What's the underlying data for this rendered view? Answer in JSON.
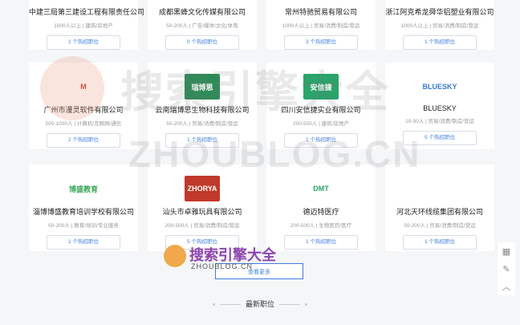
{
  "cards": [
    {
      "name": "中建三局第三建设工程有限责任公司",
      "meta": "1000人以上 | 建筑/房地产",
      "jobs": "1 个热招职位",
      "logo_text": "",
      "logo_bg": "#ffffff",
      "logo_color": "#333333"
    },
    {
      "name": "成都黑蜂文化传媒有限公司",
      "meta": "50-200人 | 广告/媒体/文化/体育",
      "jobs": "0 个热招职位",
      "logo_text": "",
      "logo_bg": "#ffffff",
      "logo_color": "#333333"
    },
    {
      "name": "常州特驰贸易有限公司",
      "meta": "1000人以上 | 贸易/消费/制造/营运",
      "jobs": "3 个热招职位",
      "logo_text": "",
      "logo_bg": "#ffffff",
      "logo_color": "#333333"
    },
    {
      "name": "浙江阿克希龙舜华铝塑业有限公司",
      "meta": "1000人以上 | 贸易/消费/制造/营运",
      "jobs": "1 个热招职位",
      "logo_text": "",
      "logo_bg": "#ffffff",
      "logo_color": "#333333"
    },
    {
      "name": "广州市漫灵软件有限公司",
      "meta": "500-1000人 | 计算机/互联网/通信",
      "jobs": "2 个热招职位",
      "logo_text": "M",
      "logo_bg": "#ffffff",
      "logo_color": "#c0392b"
    },
    {
      "name": "云南瑞博思生物科技有限公司",
      "meta": "50-200人 | 贸易/消费/制造/营运",
      "jobs": "1 个热招职位",
      "logo_text": "瑞博思",
      "logo_bg": "#2e8b57",
      "logo_color": "#ffffff"
    },
    {
      "name": "四川安信捷实业有限公司",
      "meta": "200-500人 | 建筑/房地产",
      "jobs": "1 个热招职位",
      "logo_text": "安信捷",
      "logo_bg": "#2aa46b",
      "logo_color": "#ffffff"
    },
    {
      "name": "BLUESKY",
      "meta": "10-50人 | 贸易/消费/制造/营运",
      "jobs": "5 个热招职位",
      "logo_text": "BLUESKY",
      "logo_bg": "#ffffff",
      "logo_color": "#3a7bd5"
    },
    {
      "name": "淄博博盛教育培训学校有限公司",
      "meta": "50-200人 | 教育/培训/专业服务",
      "jobs": "1 个热招职位",
      "logo_text": "博盛教育",
      "logo_bg": "#ffffff",
      "logo_color": "#3aa655"
    },
    {
      "name": "汕头市卓雅玩具有限公司",
      "meta": "200-500人 | 贸易/消费/制造/营运",
      "jobs": "5 个热招职位",
      "logo_text": "ZHORYA",
      "logo_bg": "#c0392b",
      "logo_color": "#ffffff"
    },
    {
      "name": "德迈特医疗",
      "meta": "200-500人 | 生物医药/医疗",
      "jobs": "1 个热招职位",
      "logo_text": "DMT",
      "logo_bg": "#ffffff",
      "logo_color": "#2aa46b"
    },
    {
      "name": "河北天环线缆集团有限公司",
      "meta": "50-200人 | 贸易/消费/制造/营运",
      "jobs": "1 个热招职位",
      "logo_text": "",
      "logo_bg": "#ffffff",
      "logo_color": "#1f4e8c"
    }
  ],
  "more_label": "查看更多",
  "latest_title": "最新职位",
  "watermark": {
    "cn": "搜索引擎大全",
    "en": "ZHOUBLOG.CN"
  },
  "colors": {
    "accent": "#3f7de0",
    "muted": "#999999"
  },
  "sidetools": [
    {
      "icon": "qrcode-icon",
      "glyph": "▦"
    },
    {
      "icon": "edit-icon",
      "glyph": "✎"
    },
    {
      "icon": "chevron-up-icon",
      "glyph": "︿"
    }
  ]
}
